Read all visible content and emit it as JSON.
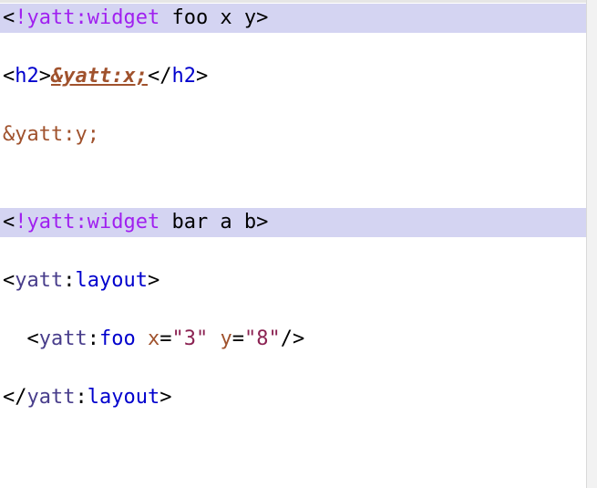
{
  "colors": {
    "highlight_bg": "#d4d4f2",
    "keyword": "#a020f0",
    "tag": "#0000cd",
    "namespace": "#483d8b",
    "entity": "#a0522d",
    "string": "#8b2252"
  },
  "lines": [
    {
      "highlighted": true,
      "tokens": [
        {
          "text": "<",
          "style": "black"
        },
        {
          "text": "!yatt:widget",
          "style": "purple"
        },
        {
          "text": " foo x y>",
          "style": "black"
        }
      ]
    },
    {
      "highlighted": false,
      "tokens": []
    },
    {
      "highlighted": false,
      "tokens": [
        {
          "text": "<",
          "style": "black"
        },
        {
          "text": "h2",
          "style": "blue"
        },
        {
          "text": ">",
          "style": "black"
        },
        {
          "text": "&yatt:x;",
          "style": "entity-bold"
        },
        {
          "text": "</",
          "style": "black"
        },
        {
          "text": "h2",
          "style": "blue"
        },
        {
          "text": ">",
          "style": "black"
        }
      ]
    },
    {
      "highlighted": false,
      "tokens": []
    },
    {
      "highlighted": false,
      "tokens": [
        {
          "text": "&yatt:y;",
          "style": "brown"
        }
      ]
    },
    {
      "highlighted": false,
      "tokens": []
    },
    {
      "highlighted": false,
      "tokens": []
    },
    {
      "highlighted": true,
      "tokens": [
        {
          "text": "<",
          "style": "black"
        },
        {
          "text": "!yatt:widget",
          "style": "purple"
        },
        {
          "text": " bar a b>",
          "style": "black"
        }
      ]
    },
    {
      "highlighted": false,
      "tokens": []
    },
    {
      "highlighted": false,
      "tokens": [
        {
          "text": "<",
          "style": "black"
        },
        {
          "text": "yatt",
          "style": "slate"
        },
        {
          "text": ":",
          "style": "black"
        },
        {
          "text": "layout",
          "style": "blue"
        },
        {
          "text": ">",
          "style": "black"
        }
      ]
    },
    {
      "highlighted": false,
      "tokens": []
    },
    {
      "highlighted": false,
      "tokens": [
        {
          "text": "  <",
          "style": "black"
        },
        {
          "text": "yatt",
          "style": "slate"
        },
        {
          "text": ":",
          "style": "black"
        },
        {
          "text": "foo",
          "style": "blue"
        },
        {
          "text": " ",
          "style": "black"
        },
        {
          "text": "x",
          "style": "brown"
        },
        {
          "text": "=",
          "style": "black"
        },
        {
          "text": "\"3\"",
          "style": "string"
        },
        {
          "text": " ",
          "style": "black"
        },
        {
          "text": "y",
          "style": "brown"
        },
        {
          "text": "=",
          "style": "black"
        },
        {
          "text": "\"8\"",
          "style": "string"
        },
        {
          "text": "/>",
          "style": "black"
        }
      ]
    },
    {
      "highlighted": false,
      "tokens": []
    },
    {
      "highlighted": false,
      "tokens": [
        {
          "text": "</",
          "style": "black"
        },
        {
          "text": "yatt",
          "style": "slate"
        },
        {
          "text": ":",
          "style": "black"
        },
        {
          "text": "layout",
          "style": "blue"
        },
        {
          "text": ">",
          "style": "black"
        }
      ]
    }
  ]
}
